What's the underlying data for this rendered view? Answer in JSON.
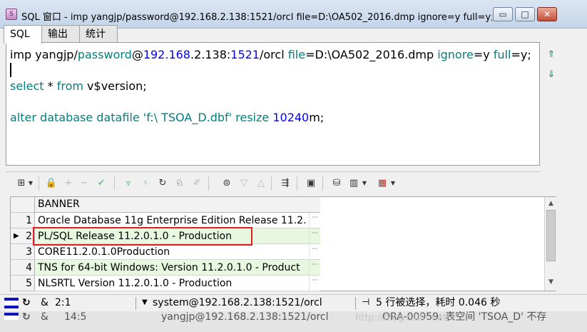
{
  "window": {
    "title": "SQL 窗口 - imp yangjp/password@192.168.2.138:1521/orcl file=D:\\OA502_2016.dmp ignore=y full=y; select * fr...",
    "controls": {
      "minimize": "▭",
      "maximize": "□",
      "close": "✕"
    }
  },
  "tabs": [
    "SQL",
    "输出",
    "统计"
  ],
  "editor": {
    "line1": {
      "p1": "imp yangjp/",
      "p2": "password",
      "p3": "@",
      "p4": "192.168",
      "p5": ".2.138:",
      "p6": "1521",
      "p7": "/orcl ",
      "p8": "file",
      "p9": "=D:\\OA502_2016.dmp ",
      "p10": "ignore",
      "p11": "=y ",
      "p12": "full",
      "p13": "=y;"
    },
    "line2": {
      "p1": "select",
      "p2": " * ",
      "p3": "from",
      "p4": " v$version;"
    },
    "line3": {
      "p1": "alter database datafile ",
      "p2": "'f:\\ TSOA_D.dbf'",
      "p3": " resize ",
      "p4": "10240",
      "p5": "m;"
    }
  },
  "grid": {
    "column": "BANNER",
    "rows": [
      {
        "num": "1",
        "value": "Oracle Database 11g Enterprise Edition Release 11.2."
      },
      {
        "num": "2",
        "value": "PL/SQL Release 11.2.0.1.0 - Production"
      },
      {
        "num": "3",
        "value": "CORE11.2.0.1.0Production"
      },
      {
        "num": "4",
        "value": "TNS for 64-bit Windows: Version 11.2.0.1.0 - Product"
      },
      {
        "num": "5",
        "value": "NLSRTL Version 11.2.0.1.0 - Production"
      }
    ],
    "more": "···"
  },
  "status": {
    "ampersand": "&",
    "position": "2:1",
    "connection": "system@192.168.2.138:1521/orcl",
    "message": "5 行被选择，耗时 0.046 秒"
  },
  "status2": {
    "ampersand": "&",
    "position": "14:5",
    "connection": "yangjp@192.168.2.138:1521/orcl",
    "message": "ORA-00959: 表空间 'TSOA_D' 不存"
  },
  "watermark": "http://blog.csdn.net/",
  "colors": {
    "keyword": "#008080",
    "number": "#0000ff",
    "highlight_row": "#e8f8e0",
    "red_box": "#e02020"
  }
}
